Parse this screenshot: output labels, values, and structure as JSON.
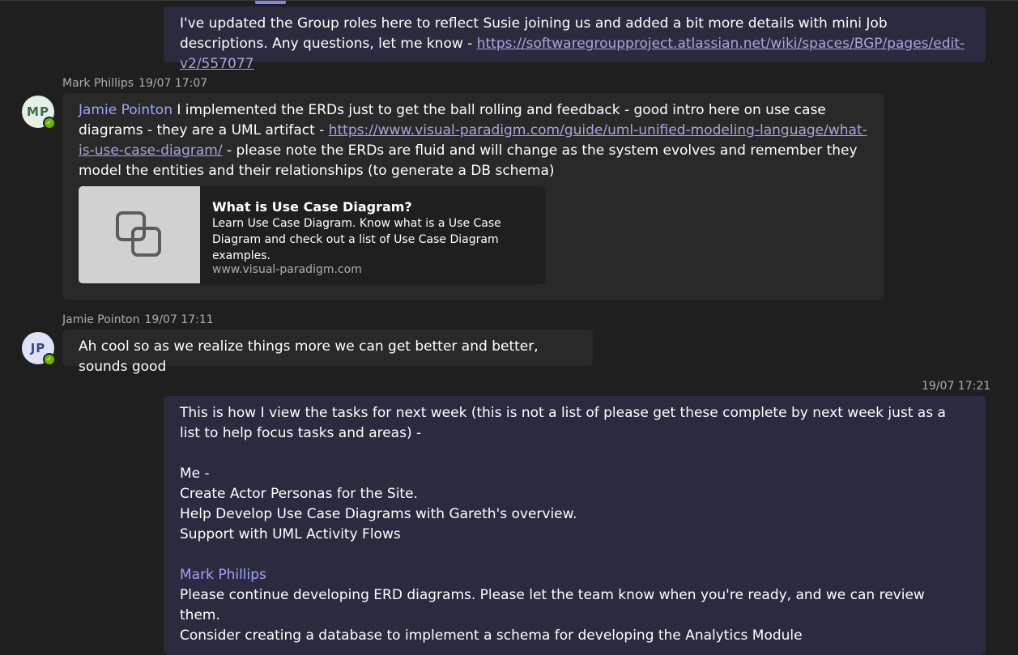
{
  "messages": {
    "m1": {
      "text": "I've updated the Group roles here to reflect Susie joining us and added a bit more details with mini Job descriptions. Any questions, let me know - ",
      "link": "https://softwaregroupproject.atlassian.net/wiki/spaces/BGP/pages/edit-v2/557077"
    },
    "m2": {
      "author": "Mark Phillips",
      "time": "19/07 17:07",
      "initials": "MP",
      "mention": "Jamie Pointon",
      "text1": " I implemented the ERDs just to get the ball rolling and feedback - good intro here on use case diagrams  - they are a UML artifact -  ",
      "link": "https://www.visual-paradigm.com/guide/uml-unified-modeling-language/what-is-use-case-diagram/",
      "text2": " - please note the ERDs are fluid and will change as the system evolves and remember they model the entities and their relationships (to generate a DB schema)",
      "card": {
        "title": "What is Use Case Diagram?",
        "description": "Learn Use Case Diagram. Know what is a Use Case Diagram and check out a list of Use Case Diagram examples.",
        "domain": "www.visual-paradigm.com",
        "thumb_icon": "link-icon"
      }
    },
    "m3": {
      "author": "Jamie Pointon",
      "time": "19/07 17:11",
      "initials": "JP",
      "text": "Ah cool so as we realize things more we can get better and better, sounds good"
    },
    "m4": {
      "time": "19/07 17:21",
      "intro": "This is how I view the tasks for next week (this is not a list of please get these complete by next week just as a list to help focus tasks and areas) -",
      "me_label": "Me -",
      "me_tasks": [
        "Create Actor Personas for the Site.",
        "Help Develop Use Case Diagrams with Gareth's overview.",
        "Support with UML Activity Flows"
      ],
      "mention": "Mark Phillips",
      "mark_tasks": [
        "Please continue developing ERD diagrams. Please let the team know when you're ready, and we can review them.",
        "Consider creating a database to implement a schema for developing the Analytics Module"
      ]
    }
  },
  "colors": {
    "background": "#1f1f1f",
    "self_bubble": "#2b2b40",
    "other_bubble": "#292929",
    "mention": "#9ea2ff",
    "link": "#a6a7dc",
    "presence_available": "#6bb700"
  }
}
